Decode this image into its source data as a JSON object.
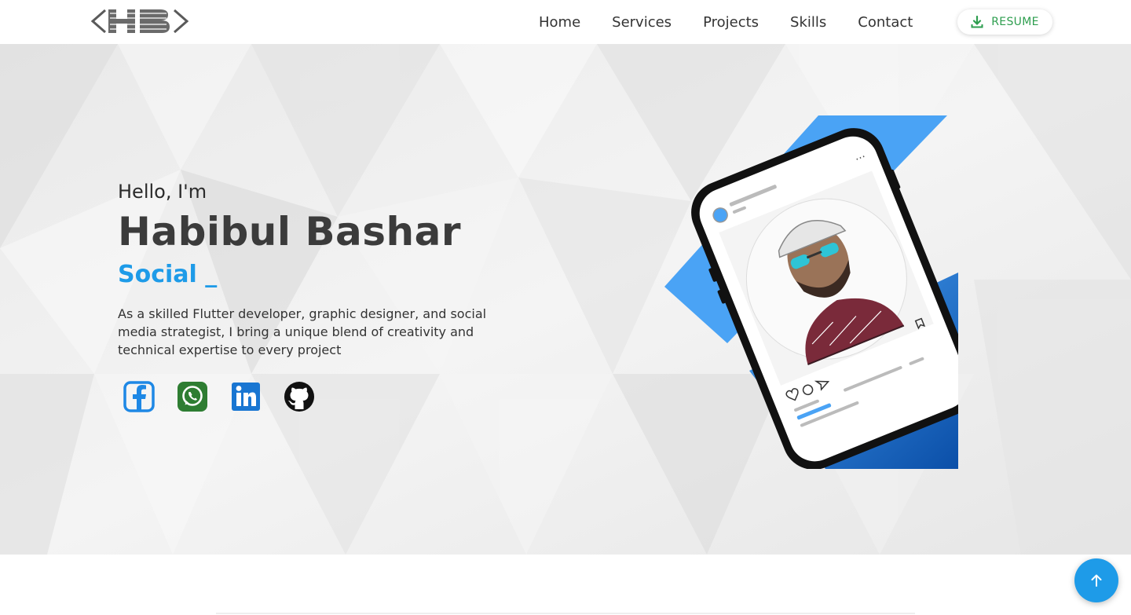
{
  "brand": {
    "logo_icon": "hb-monogram-logo"
  },
  "nav": {
    "links": [
      {
        "label": "Home"
      },
      {
        "label": "Services"
      },
      {
        "label": "Projects"
      },
      {
        "label": "Skills"
      },
      {
        "label": "Contact"
      }
    ],
    "resume_label": "RESUME",
    "resume_icon": "download-icon",
    "resume_color": "#2e9e4f"
  },
  "hero": {
    "greeting": "Hello, I'm",
    "name": "Habibul Bashar",
    "typed_text": "Social _",
    "description": "As a skilled Flutter developer, graphic designer, and social media strategist, I bring a unique blend of creativity and technical expertise to every project",
    "accent_color": "#1e9be8",
    "socials": [
      {
        "icon": "facebook-icon",
        "color": "#1e88e5"
      },
      {
        "icon": "whatsapp-icon",
        "color": "#2e7d32"
      },
      {
        "icon": "linkedin-icon",
        "color": "#1976d2"
      },
      {
        "icon": "github-icon",
        "color": "#111111"
      }
    ],
    "illustration": "phone-profile-illustration"
  },
  "scroll_top_icon": "arrow-up-icon"
}
